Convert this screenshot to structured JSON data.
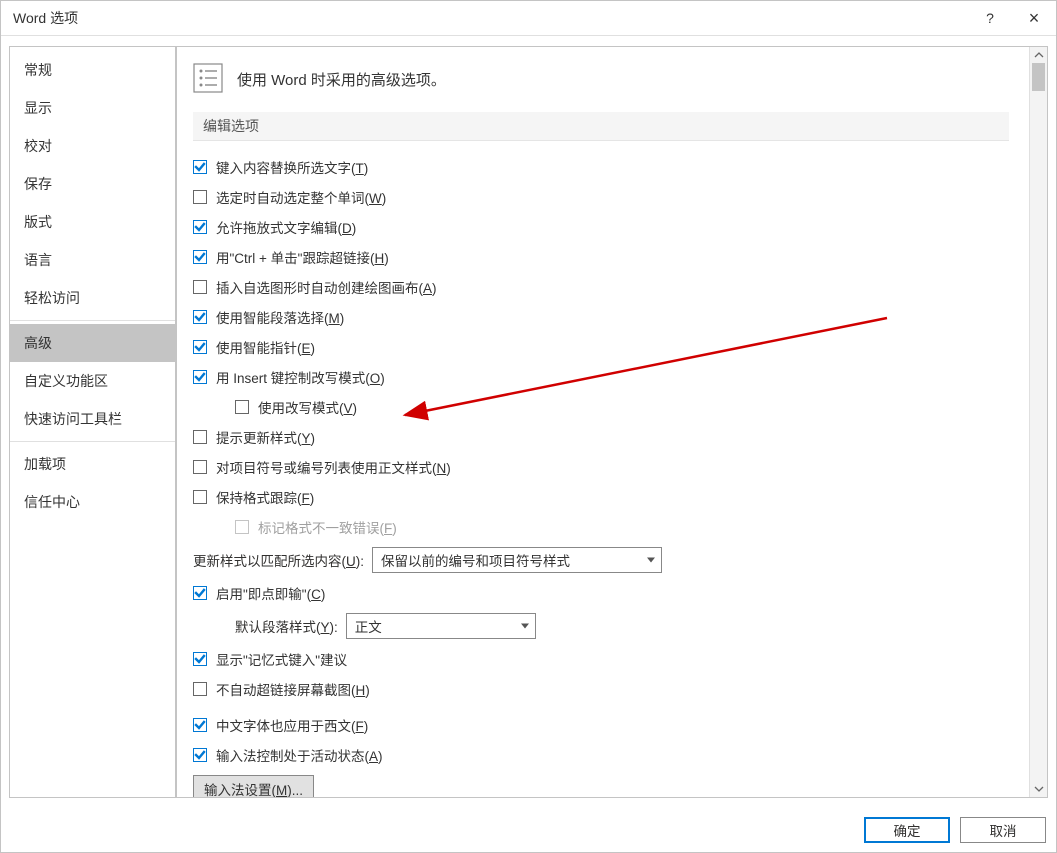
{
  "titlebar": {
    "title": "Word 选项",
    "help": "?",
    "close": "×"
  },
  "sidebar": {
    "items": [
      "常规",
      "显示",
      "校对",
      "保存",
      "版式",
      "语言",
      "轻松访问",
      "高级",
      "自定义功能区",
      "快速访问工具栏",
      "加载项",
      "信任中心"
    ],
    "selected": "高级"
  },
  "header": {
    "heading": "使用 Word 时采用的高级选项。"
  },
  "section": {
    "label": "编辑选项"
  },
  "options": [
    {
      "checked": true,
      "text": "键入内容替换所选文字(",
      "ak": "T",
      "tail": ")"
    },
    {
      "checked": false,
      "text": "选定时自动选定整个单词(",
      "ak": "W",
      "tail": ")"
    },
    {
      "checked": true,
      "text": "允许拖放式文字编辑(",
      "ak": "D",
      "tail": ")"
    },
    {
      "checked": true,
      "text": "用\"Ctrl + 单击\"跟踪超链接(",
      "ak": "H",
      "tail": ")"
    },
    {
      "checked": false,
      "text": "插入自选图形时自动创建绘图画布(",
      "ak": "A",
      "tail": ")"
    },
    {
      "checked": true,
      "text": "使用智能段落选择(",
      "ak": "M",
      "tail": ")"
    },
    {
      "checked": true,
      "text": "使用智能指针(",
      "ak": "E",
      "tail": ")"
    },
    {
      "checked": true,
      "text": "用 Insert 键控制改写模式(",
      "ak": "O",
      "tail": ")"
    },
    {
      "checked": false,
      "indent": 1,
      "text": "使用改写模式(",
      "ak": "V",
      "tail": ")"
    },
    {
      "checked": false,
      "text": "提示更新样式(",
      "ak": "Y",
      "tail": ")"
    },
    {
      "checked": false,
      "text": "对项目符号或编号列表使用正文样式(",
      "ak": "N",
      "tail": ")"
    },
    {
      "checked": false,
      "text": "保持格式跟踪(",
      "ak": "F",
      "tail": ")"
    },
    {
      "checked": false,
      "indent": 2,
      "disabled": true,
      "text": "标记格式不一致错误(",
      "ak": "F",
      "tail": ")"
    }
  ],
  "row_style_match": {
    "label_pre": "更新样式以匹配所选内容(",
    "ak": "U",
    "label_post": "):",
    "select_value": "保留以前的编号和项目符号样式"
  },
  "opt_click_type": {
    "checked": true,
    "text": "启用\"即点即输\"(",
    "ak": "C",
    "tail": ")"
  },
  "row_default_para": {
    "label_pre": "默认段落样式(",
    "ak": "Y",
    "label_post": "):",
    "select_value": "正文"
  },
  "opt_autocomplete": {
    "checked": true,
    "text": "显示\"记忆式键入\"建议"
  },
  "opt_no_hyperlink_screenshot": {
    "checked": false,
    "text": "不自动超链接屏幕截图(",
    "ak": "H",
    "tail": ")"
  },
  "opt_cjk_latin": {
    "checked": true,
    "text": "中文字体也应用于西文(",
    "ak": "F",
    "tail": ")"
  },
  "opt_ime_active": {
    "checked": true,
    "text": "输入法控制处于活动状态(",
    "ak": "A",
    "tail": ")"
  },
  "btn_ime": {
    "pre": "输入法设置(",
    "ak": "M",
    "post": ")..."
  },
  "footer": {
    "ok": "确定",
    "cancel": "取消"
  }
}
